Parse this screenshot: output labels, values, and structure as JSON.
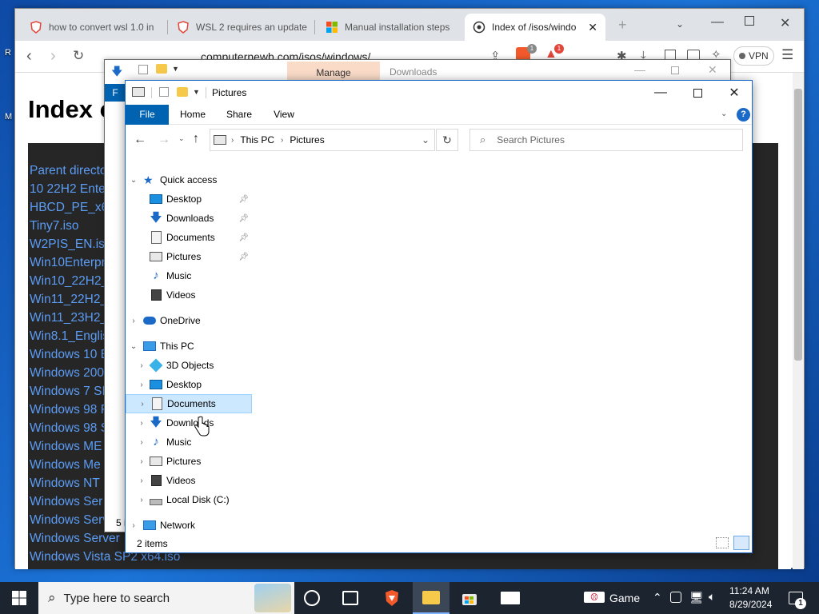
{
  "browser": {
    "tabs": [
      {
        "label": "how to convert wsl 1.0 in"
      },
      {
        "label": "WSL 2 requires an update"
      },
      {
        "label": "Manual installation steps"
      },
      {
        "label": "Index of /isos/windo"
      }
    ],
    "url": "computernewb.com/isos/windows/",
    "vpn_label": "VPN",
    "page_heading": "Index o",
    "listing": [
      "Parent directo",
      "10 22H2 Ente",
      "HBCD_PE_x64",
      "Tiny7.iso",
      "W2PIS_EN.iso",
      "Win10Enterpr",
      "Win10_22H2_",
      "Win11_22H2_",
      "Win11_23H2_",
      "Win8.1_Englis",
      "Windows 10 E",
      "Windows 200",
      "Windows 7 SI",
      "Windows 98 F",
      "Windows 98 S",
      "Windows ME",
      "Windows Me",
      "Windows NT",
      "Windows Ser",
      "Windows Serv",
      "Windows Server",
      "Windows Vista SP2 x64.iso"
    ]
  },
  "explorer_back": {
    "manage_label": "Manage",
    "downloads_label": "Downloads",
    "ribbon_file": "F",
    "status_count": "5 i"
  },
  "explorer": {
    "title": "Pictures",
    "ribbon": {
      "file": "File",
      "home": "Home",
      "share": "Share",
      "view": "View"
    },
    "breadcrumb": [
      "This PC",
      "Pictures"
    ],
    "search_placeholder": "Search Pictures",
    "quick_access": {
      "label": "Quick access",
      "items": [
        {
          "label": "Desktop",
          "pinned": true
        },
        {
          "label": "Downloads",
          "pinned": true
        },
        {
          "label": "Documents",
          "pinned": true
        },
        {
          "label": "Pictures",
          "pinned": true
        },
        {
          "label": "Music",
          "pinned": false
        },
        {
          "label": "Videos",
          "pinned": false
        }
      ]
    },
    "onedrive": "OneDrive",
    "this_pc": {
      "label": "This PC",
      "items": [
        {
          "label": "3D Objects"
        },
        {
          "label": "Desktop"
        },
        {
          "label": "Documents"
        },
        {
          "label": "Downloads"
        },
        {
          "label": "Music"
        },
        {
          "label": "Pictures"
        },
        {
          "label": "Videos"
        },
        {
          "label": "Local Disk (C:)"
        }
      ]
    },
    "network": "Network",
    "status": "2 items"
  },
  "taskbar": {
    "search_placeholder": "Type here to search",
    "game_label": "Game",
    "time": "11:24 AM",
    "date": "8/29/2024",
    "notification_count": "1"
  },
  "colors": {
    "accent": "#0063b1",
    "link": "#5b9cf5",
    "listing_bg": "#262626",
    "selection": "#cce8ff"
  }
}
